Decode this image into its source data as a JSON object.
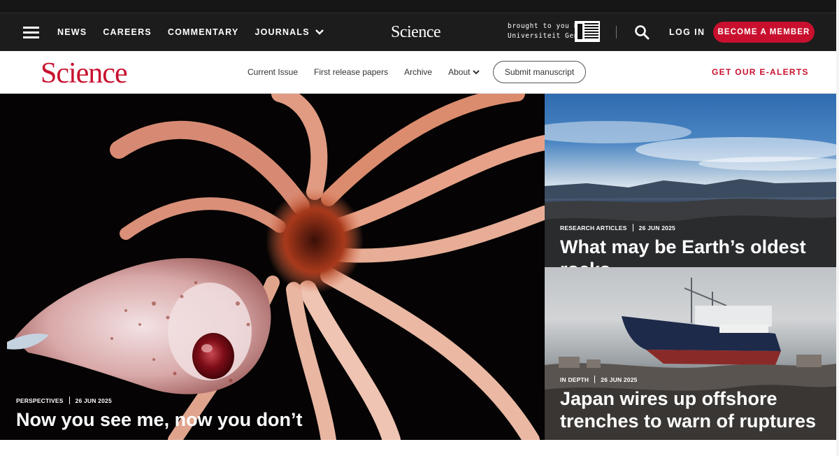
{
  "top_nav": {
    "items": [
      "NEWS",
      "CAREERS",
      "COMMENTARY",
      "JOURNALS"
    ],
    "brand": "Science",
    "sponsor_line1": "brought to you by",
    "sponsor_line2": "Universiteit Gent",
    "login": "LOG IN",
    "member_button": "BECOME A MEMBER"
  },
  "sub_nav": {
    "logo": "Science",
    "links": [
      "Current Issue",
      "First release papers",
      "Archive",
      "About"
    ],
    "submit_button": "Submit manuscript",
    "ealerts": "GET OUR E-ALERTS"
  },
  "features": [
    {
      "section": "PERSPECTIVES",
      "date": "26 JUN 2025",
      "headline": "Now you see me, now you don’t"
    },
    {
      "section": "RESEARCH ARTICLES",
      "date": "26 JUN 2025",
      "headline": "What may be Earth’s oldest rocks"
    },
    {
      "section": "IN DEPTH",
      "date": "26 JUN 2025",
      "headline": "Japan wires up offshore trenches to warn of ruptures"
    }
  ],
  "colors": {
    "brand_red": "#c8102e",
    "topbar": "#1c1c1c"
  },
  "icons": [
    "menu-icon",
    "chevron-down-icon",
    "search-icon"
  ]
}
